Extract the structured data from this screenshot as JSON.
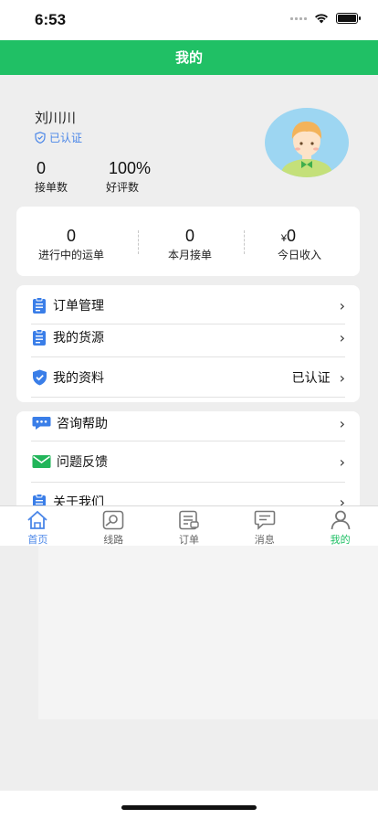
{
  "status_bar": {
    "time": "6:53"
  },
  "nav": {
    "title": "我的"
  },
  "profile": {
    "name": "刘川川",
    "verified_label": "已认证",
    "stats": [
      {
        "value": "0",
        "label": "接单数"
      },
      {
        "value": "100%",
        "label": "好评数"
      }
    ]
  },
  "summary": [
    {
      "value": "0",
      "label": "进行中的运单"
    },
    {
      "value": "0",
      "label": "本月接单"
    },
    {
      "currency": "¥",
      "value": "0",
      "label": "今日收入"
    }
  ],
  "menu_group_1": [
    {
      "label": "订单管理",
      "icon": "clipboard-icon",
      "value": ""
    },
    {
      "label": "我的货源",
      "icon": "clipboard-icon",
      "value": ""
    },
    {
      "label": "我的资料",
      "icon": "shield-check-icon",
      "value": "已认证"
    }
  ],
  "menu_group_2": [
    {
      "label": "咨询帮助",
      "icon": "chat-bubble-icon"
    },
    {
      "label": "问题反馈",
      "icon": "envelope-icon"
    },
    {
      "label": "关于我们",
      "icon": "clipboard-icon"
    }
  ],
  "tabs": [
    {
      "label": "首页",
      "icon": "home-icon"
    },
    {
      "label": "线路",
      "icon": "route-icon"
    },
    {
      "label": "订单",
      "icon": "order-icon"
    },
    {
      "label": "消息",
      "icon": "message-icon"
    },
    {
      "label": "我的",
      "icon": "user-icon",
      "active": true
    }
  ],
  "colors": {
    "brand_green": "#20c065",
    "accent_blue": "#4a86e8",
    "background": "#eeeeee"
  }
}
